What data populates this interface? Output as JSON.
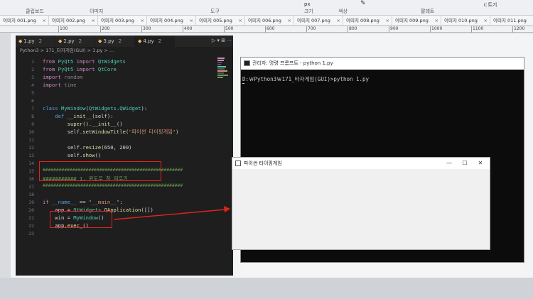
{
  "paint": {
    "groups": [
      "클립보드",
      "이미지",
      "도구",
      "크기",
      "색상",
      "팔레트"
    ],
    "extra": [
      "px",
      "ㄷ트기"
    ],
    "tabs": [
      "이미지 001.png",
      "이미지 002.png",
      "이미지 003.png",
      "이미지 004.png",
      "이미지 005.png",
      "이미지 006.png",
      "이미지 007.png",
      "이미지 008.png",
      "이미지 009.png",
      "이미지 010.png",
      "이미지 011.png"
    ],
    "ruler": [
      "100",
      "200",
      "300",
      "400",
      "500",
      "600",
      "700",
      "800",
      "900",
      "1000",
      "1100",
      "1200"
    ]
  },
  "vscode": {
    "tabs": [
      {
        "name": "1.py",
        "count": "2"
      },
      {
        "name": "2.py",
        "count": "2"
      },
      {
        "name": "3.py",
        "count": "2"
      },
      {
        "name": "4.py",
        "count": "2"
      }
    ],
    "actions": "▷ ▾ ⊞ ···",
    "breadcrumb": "Python3 > 171_타자게임(GUI) > 1.py > ...",
    "line_numbers": [
      "1",
      "2",
      "3",
      "4",
      "5",
      "6",
      "7",
      "8",
      "9",
      "10",
      "11",
      "12",
      "13",
      "14",
      "15",
      "16",
      "17",
      "18",
      "19",
      "20",
      "21",
      "22",
      "23"
    ],
    "code": {
      "l1": [
        "from ",
        "PyQt5",
        " import ",
        "QtWidgets"
      ],
      "l2": [
        "from ",
        "PyQt5",
        " import ",
        "QtCore"
      ],
      "l3": [
        "import ",
        "random"
      ],
      "l4": [
        "import ",
        "time"
      ],
      "l7": [
        "class ",
        "MyWindow",
        "(",
        "QtWidgets",
        ".",
        "QWidget",
        "):"
      ],
      "l8": [
        "    def ",
        "__init__",
        "(self):"
      ],
      "l9": [
        "        super().",
        "__init__",
        "()"
      ],
      "l10": [
        "        self.",
        "setWindowTitle",
        "(",
        "\"파이썬 타이핑게임\"",
        ")"
      ],
      "l12": [
        "        self.",
        "resize",
        "(650, 200)"
      ],
      "l13": [
        "        self.",
        "show",
        "()"
      ],
      "l15": "####################################################",
      "l16": "########### 1. 윈도우 창 띄우기",
      "l17": "####################################################",
      "l19": [
        "if ",
        "__name__",
        " == ",
        "\"__main__\"",
        ":"
      ],
      "l20": [
        "    app = ",
        "QtWidgets",
        ".",
        "QApplication",
        "([])"
      ],
      "l21": [
        "    win = ",
        "MyWindow",
        "()"
      ],
      "l22": [
        "    app.",
        "exec_",
        "()"
      ]
    }
  },
  "cmd": {
    "title": "관리자: 명령 프롬프트 - python  1.py",
    "line": "D:￦Python3￦171_타자게임(GUI)>python 1.py"
  },
  "qt": {
    "title": "파이썬 타이핑게임",
    "min": "—",
    "max": "☐",
    "close": "✕"
  },
  "colors": {
    "annotation": "#e0241b"
  }
}
